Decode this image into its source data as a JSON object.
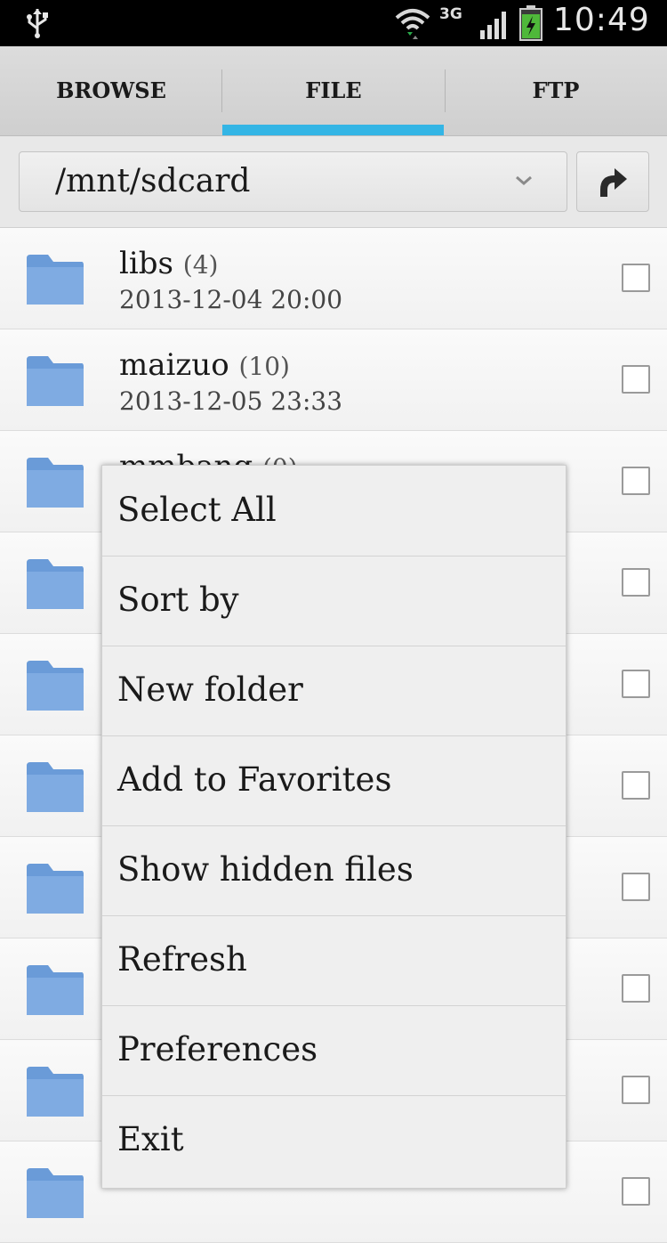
{
  "status_bar": {
    "network_type": "3G",
    "time": "10:49",
    "icons": [
      "usb-icon",
      "wifi-icon",
      "signal-icon",
      "battery-charging-icon"
    ]
  },
  "tabs": [
    {
      "label": "BROWSE",
      "selected": false
    },
    {
      "label": "FILE",
      "selected": true
    },
    {
      "label": "FTP",
      "selected": false
    }
  ],
  "accent_color": "#33b5e5",
  "path": {
    "current": "/mnt/sdcard",
    "up_button_icon": "up-arrow-icon",
    "dropdown_icon": "chevron-down-icon"
  },
  "files": [
    {
      "name": "libs",
      "count": "(4)",
      "date": "2013-12-04 20:00"
    },
    {
      "name": "maizuo",
      "count": "(10)",
      "date": "2013-12-05 23:33"
    },
    {
      "name": "mmbang",
      "count": "(0)",
      "date": ""
    },
    {
      "name": "",
      "count": "",
      "date": ""
    },
    {
      "name": "",
      "count": "",
      "date": ""
    },
    {
      "name": "",
      "count": "",
      "date": ""
    },
    {
      "name": "",
      "count": "",
      "date": ""
    },
    {
      "name": "",
      "count": "",
      "date": ""
    },
    {
      "name": "",
      "count": "",
      "date": ""
    },
    {
      "name": "",
      "count": "",
      "date": ""
    }
  ],
  "menu": {
    "items": [
      {
        "label": "Select All"
      },
      {
        "label": "Sort by"
      },
      {
        "label": "New folder"
      },
      {
        "label": "Add to Favorites"
      },
      {
        "label": "Show hidden files"
      },
      {
        "label": "Refresh"
      },
      {
        "label": "Preferences"
      },
      {
        "label": "Exit"
      }
    ]
  }
}
